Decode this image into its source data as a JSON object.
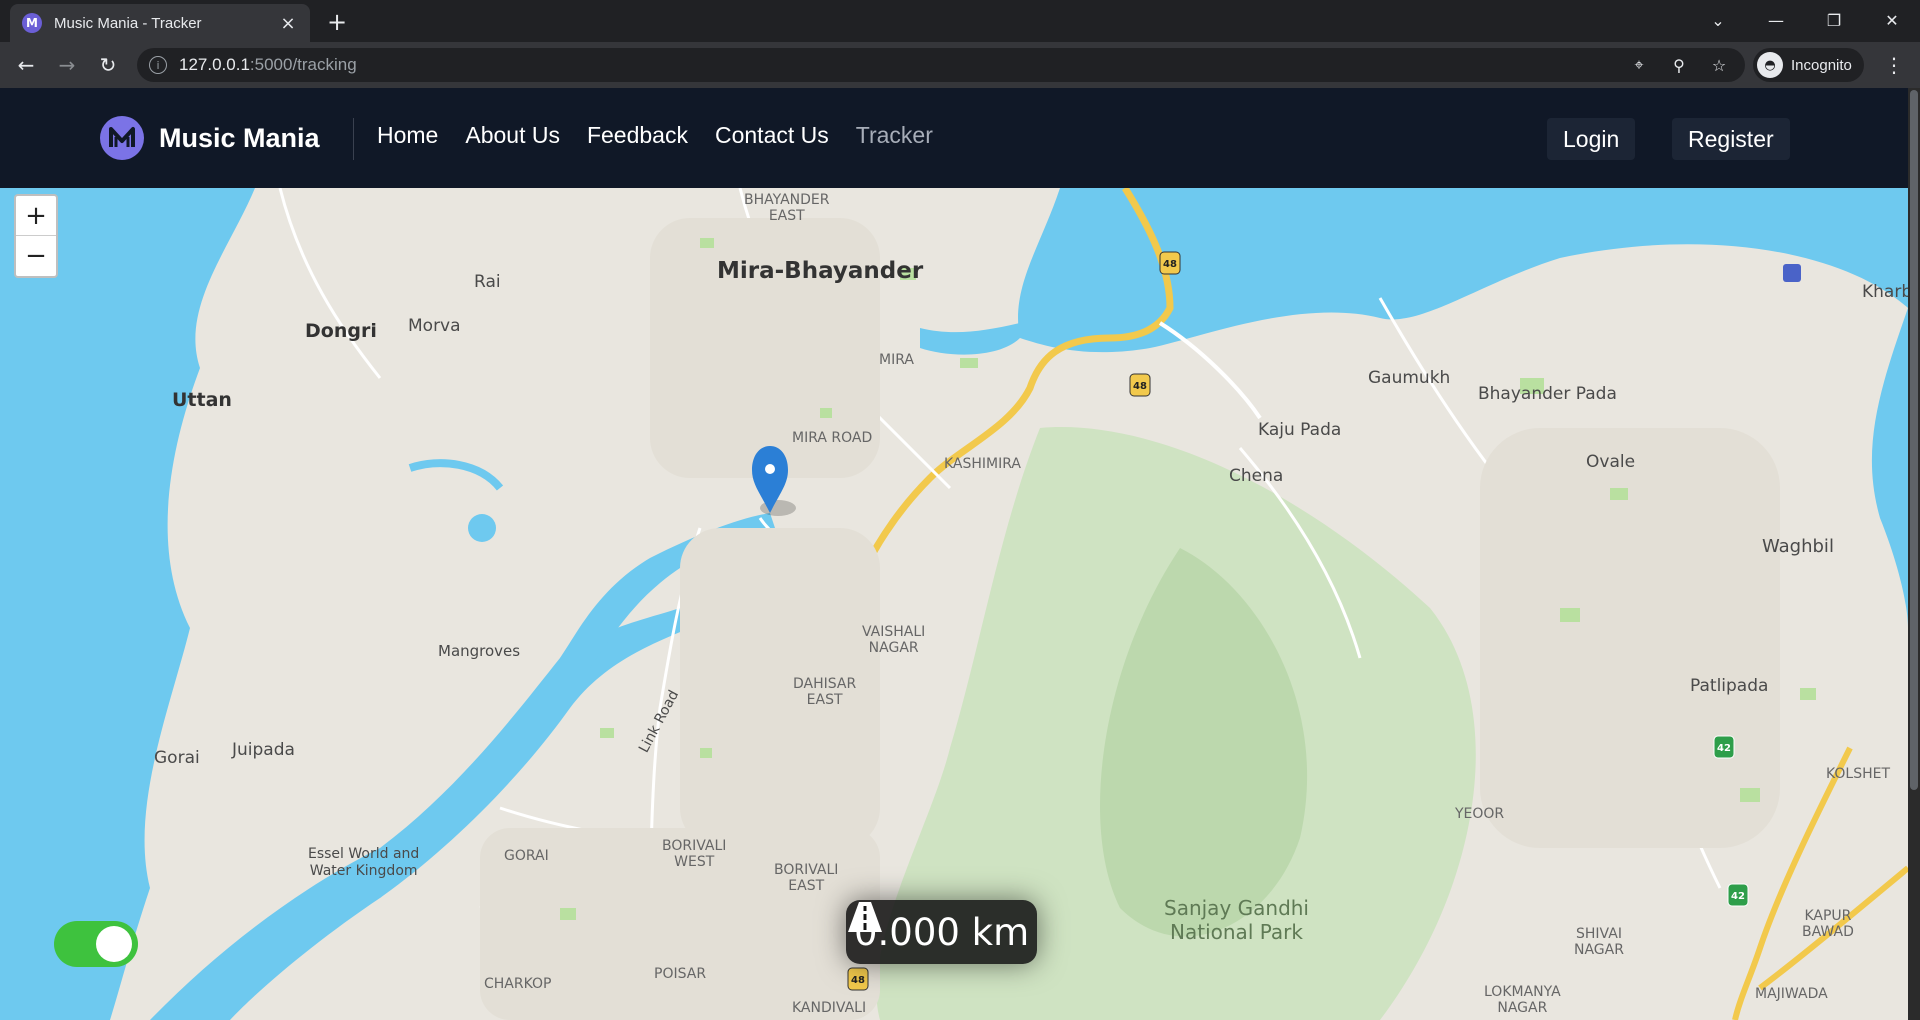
{
  "browser": {
    "tab_title": "Music Mania - Tracker",
    "tab_favicon_letter": "M",
    "url_host": "127.0.0.1",
    "url_path": ":5000/tracking",
    "profile_label": "Incognito"
  },
  "navbar": {
    "brand": "Music Mania",
    "links": [
      "Home",
      "About Us",
      "Feedback",
      "Contact Us",
      "Tracker"
    ],
    "active_link": "Tracker",
    "login_label": "Login",
    "register_label": "Register"
  },
  "map": {
    "zoom_in_label": "+",
    "zoom_out_label": "−",
    "tracking_enabled": true,
    "distance_label": "0.000 km",
    "labels": {
      "bhayander_east": "BHAYANDER\nEAST",
      "mira_bhayander": "Mira-Bhayander",
      "rai": "Rai",
      "dongri": "Dongri",
      "morva": "Morva",
      "uttan": "Uttan",
      "mira": "MIRA",
      "mira_road": "MIRA ROAD",
      "kashimira": "KASHIMIRA",
      "gaumukh": "Gaumukh",
      "bhayander_pada": "Bhayander Pada",
      "kaju_pada": "Kaju Pada",
      "chena": "Chena",
      "ovale": "Ovale",
      "kharbao": "Kharba",
      "waghbil": "Waghbil",
      "mangroves": "Mangroves",
      "vaishali_nagar": "VAISHALI\nNAGAR",
      "dahisar_east": "DAHISAR\nEAST",
      "patlipada": "Patlipada",
      "gorai": "Gorai",
      "juipada": "Juipada",
      "link_road": "Link Road",
      "yeoor": "YEOOR",
      "kolshet": "KOLSHET",
      "essel_world": "Essel World and\nWater Kingdom",
      "gorai_caps": "GORAI",
      "borivali_west": "BORIVALI\nWEST",
      "borivali_east": "BORIVALI\nEAST",
      "sanjay_gandhi": "Sanjay Gandhi\nNational Park",
      "shivai_nagar": "SHIVAI\nNAGAR",
      "kapur_bawadi": "KAPUR\nBAWAD",
      "charkop": "CHARKOP",
      "poisar": "POISAR",
      "kandivali": "KANDIVALI",
      "lokmanya_nagar": "LOKMANYA\nNAGAR",
      "majiwada": "MAJIWADA",
      "nh48": "48",
      "nh42": "42"
    }
  },
  "colors": {
    "navbar_bg": "#101827",
    "water": "#6ec9ef",
    "park": "#cfe3c2",
    "road_major": "#f2c94c",
    "toggle_on": "#3ec23e",
    "marker": "#2b7fd6"
  }
}
